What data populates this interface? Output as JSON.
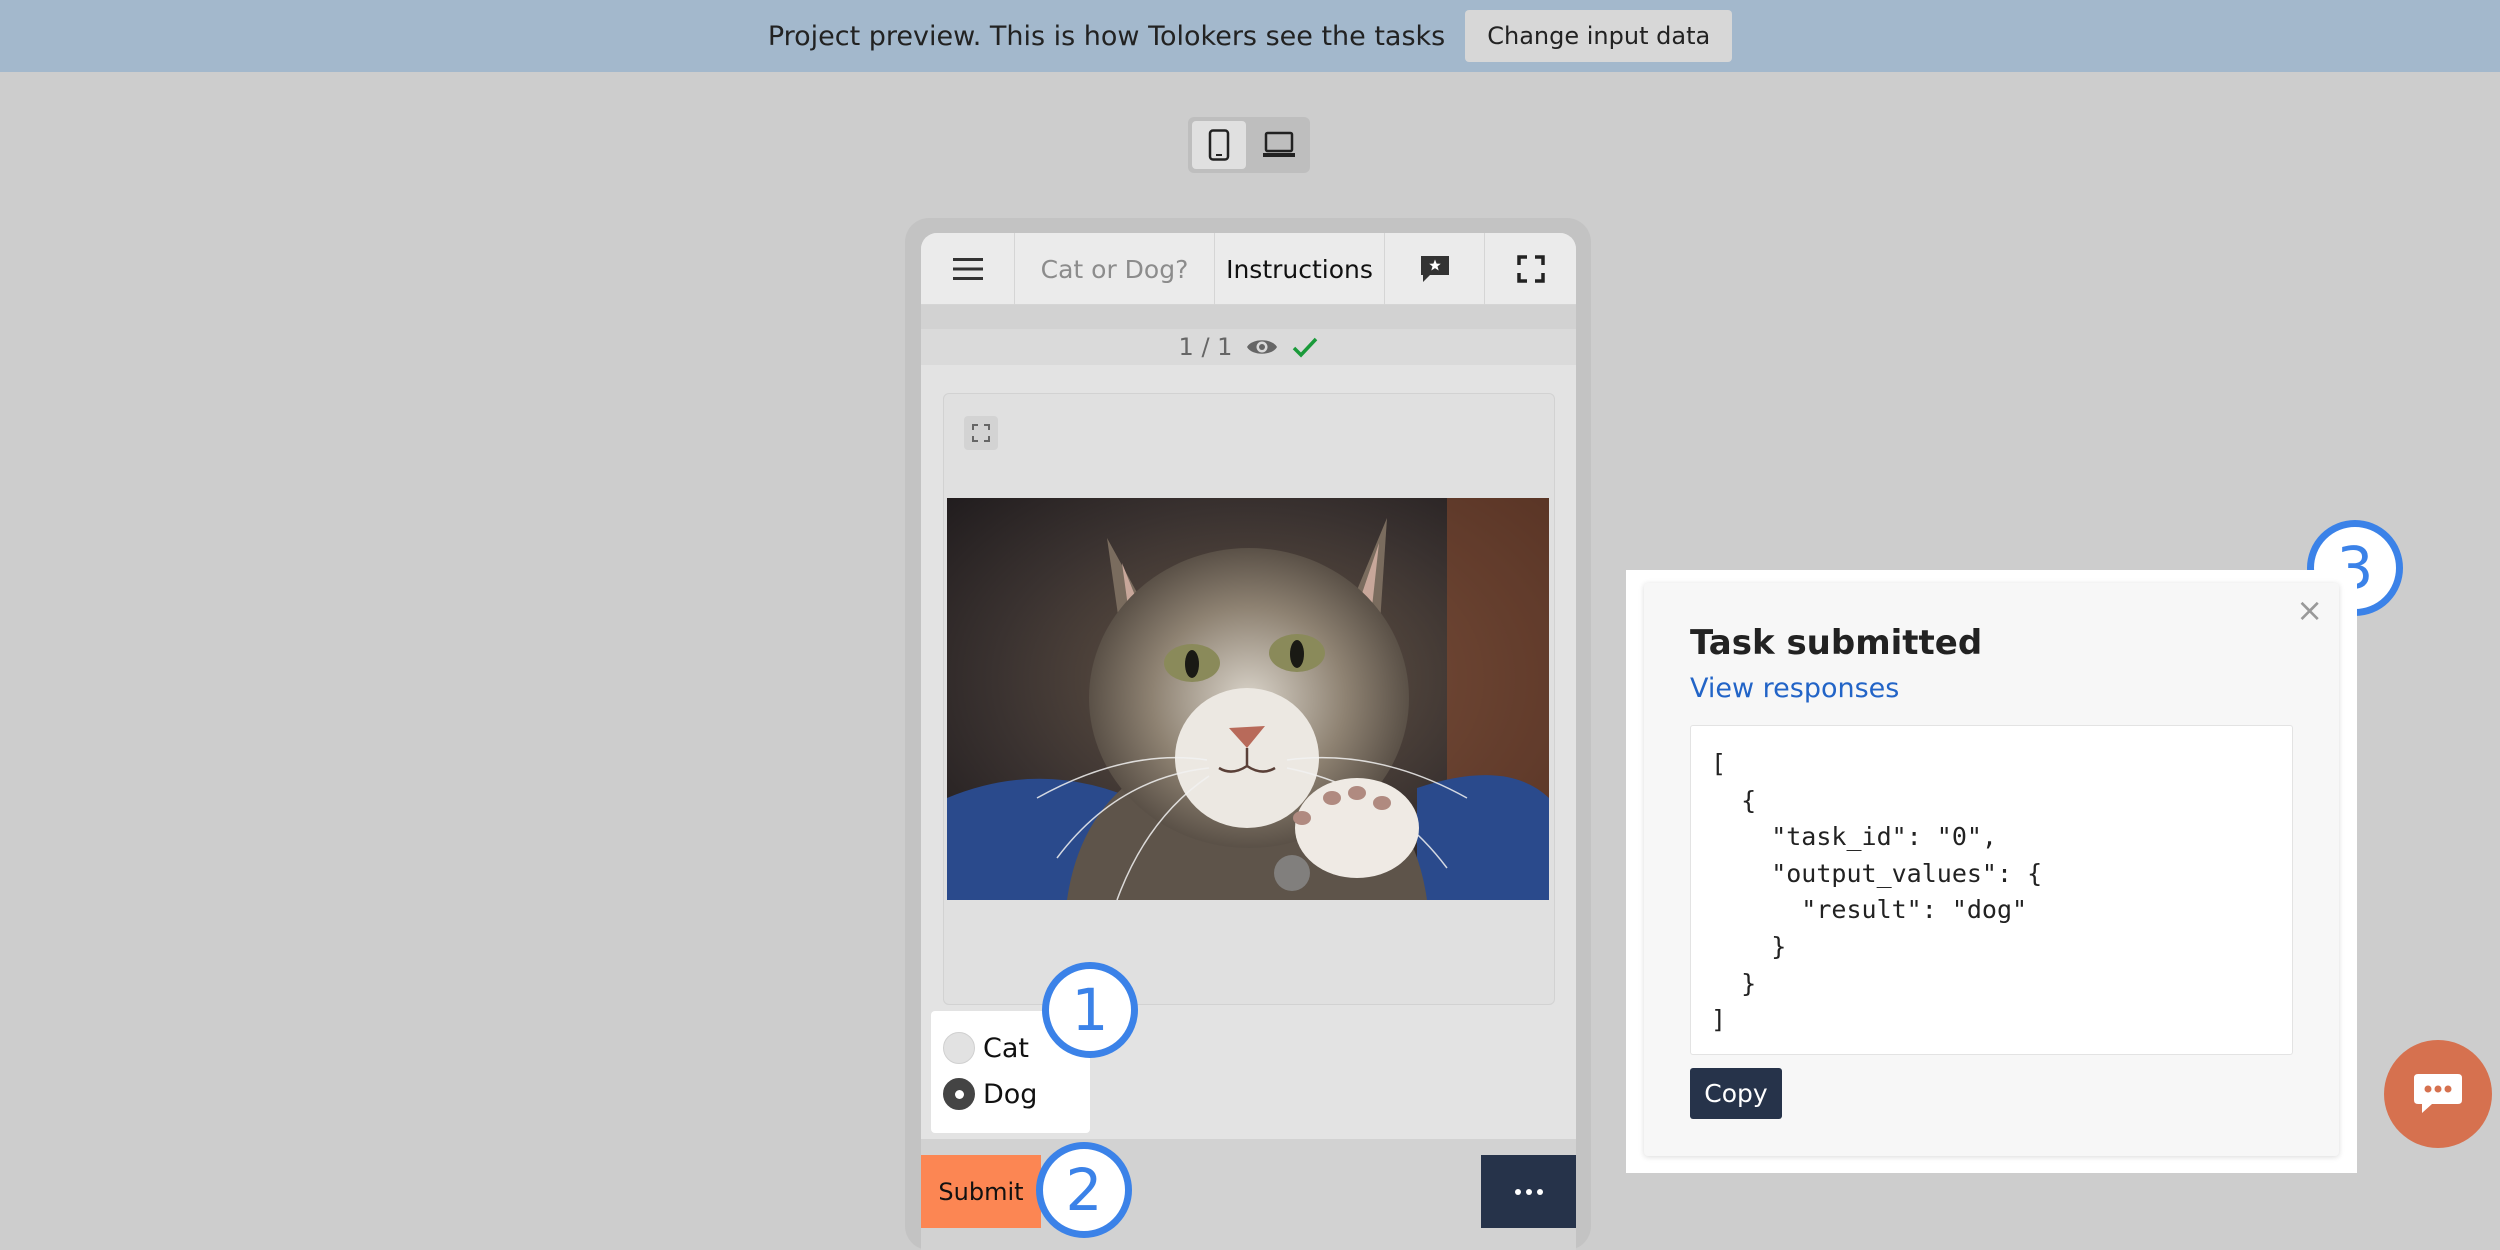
{
  "banner": {
    "text": "Project preview. This is how Tolokers see the tasks",
    "button": "Change input data"
  },
  "device_switcher": {
    "options": [
      "phone-icon",
      "laptop-icon"
    ],
    "active": "phone-icon"
  },
  "task_toolbar": {
    "menu_icon": "hamburger-menu-icon",
    "title": "Cat or Dog?",
    "instructions": "Instructions",
    "chat_icon": "message-star-icon",
    "fullscreen_icon": "fullscreen-icon"
  },
  "counter": {
    "text": "1 / 1",
    "view_icon": "eye-icon",
    "done_icon": "check-icon"
  },
  "task": {
    "expand_icon": "expand-icon",
    "image_alt": "tabby cat photo",
    "options": [
      {
        "label": "Cat",
        "checked": false
      },
      {
        "label": "Dog",
        "checked": true
      }
    ],
    "submit": "Submit",
    "more_icon": "more-icon"
  },
  "callouts": [
    "1",
    "2",
    "3"
  ],
  "popup": {
    "title": "Task submitted",
    "link": "View responses",
    "code": "[\n  {\n    \"task_id\": \"0\",\n    \"output_values\": {\n      \"result\": \"dog\"\n    }\n  }\n]",
    "copy": "Copy",
    "close": "×"
  },
  "colors": {
    "banner": "#a3b8cc",
    "submit": "#fc8653",
    "dark_button": "#26334a",
    "callout": "#3b82e8",
    "chat_fab": "#d6714f",
    "link": "#2264c7"
  }
}
